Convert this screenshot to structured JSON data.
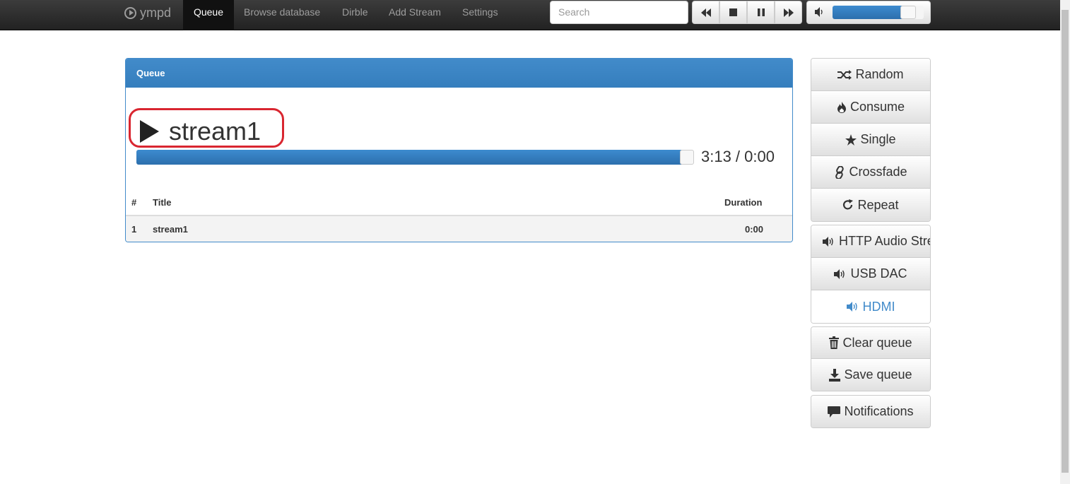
{
  "navbar": {
    "brand": "ympd",
    "items": [
      {
        "label": "Queue",
        "active": true
      },
      {
        "label": "Browse database"
      },
      {
        "label": "Dirble"
      },
      {
        "label": "Add Stream"
      },
      {
        "label": "Settings"
      }
    ],
    "search_placeholder": "Search",
    "volume_percent": 90
  },
  "queue": {
    "heading": "Queue",
    "now_playing": "stream1",
    "progress_percent": 100,
    "time": "3:13 / 0:00",
    "columns": [
      "#",
      "Title",
      "Duration"
    ],
    "rows": [
      {
        "num": "1",
        "title": "stream1",
        "duration": "0:00"
      }
    ]
  },
  "side": {
    "modes": [
      "Random",
      "Consume",
      "Single",
      "Crossfade",
      "Repeat"
    ],
    "outputs": [
      "HTTP Audio Stream",
      "USB DAC",
      "HDMI"
    ],
    "active_output": "HDMI",
    "queue_actions": [
      "Clear queue",
      "Save queue"
    ],
    "notifications": "Notifications"
  },
  "colors": {
    "accent": "#428bca",
    "highlight_circle": "#d92630"
  }
}
